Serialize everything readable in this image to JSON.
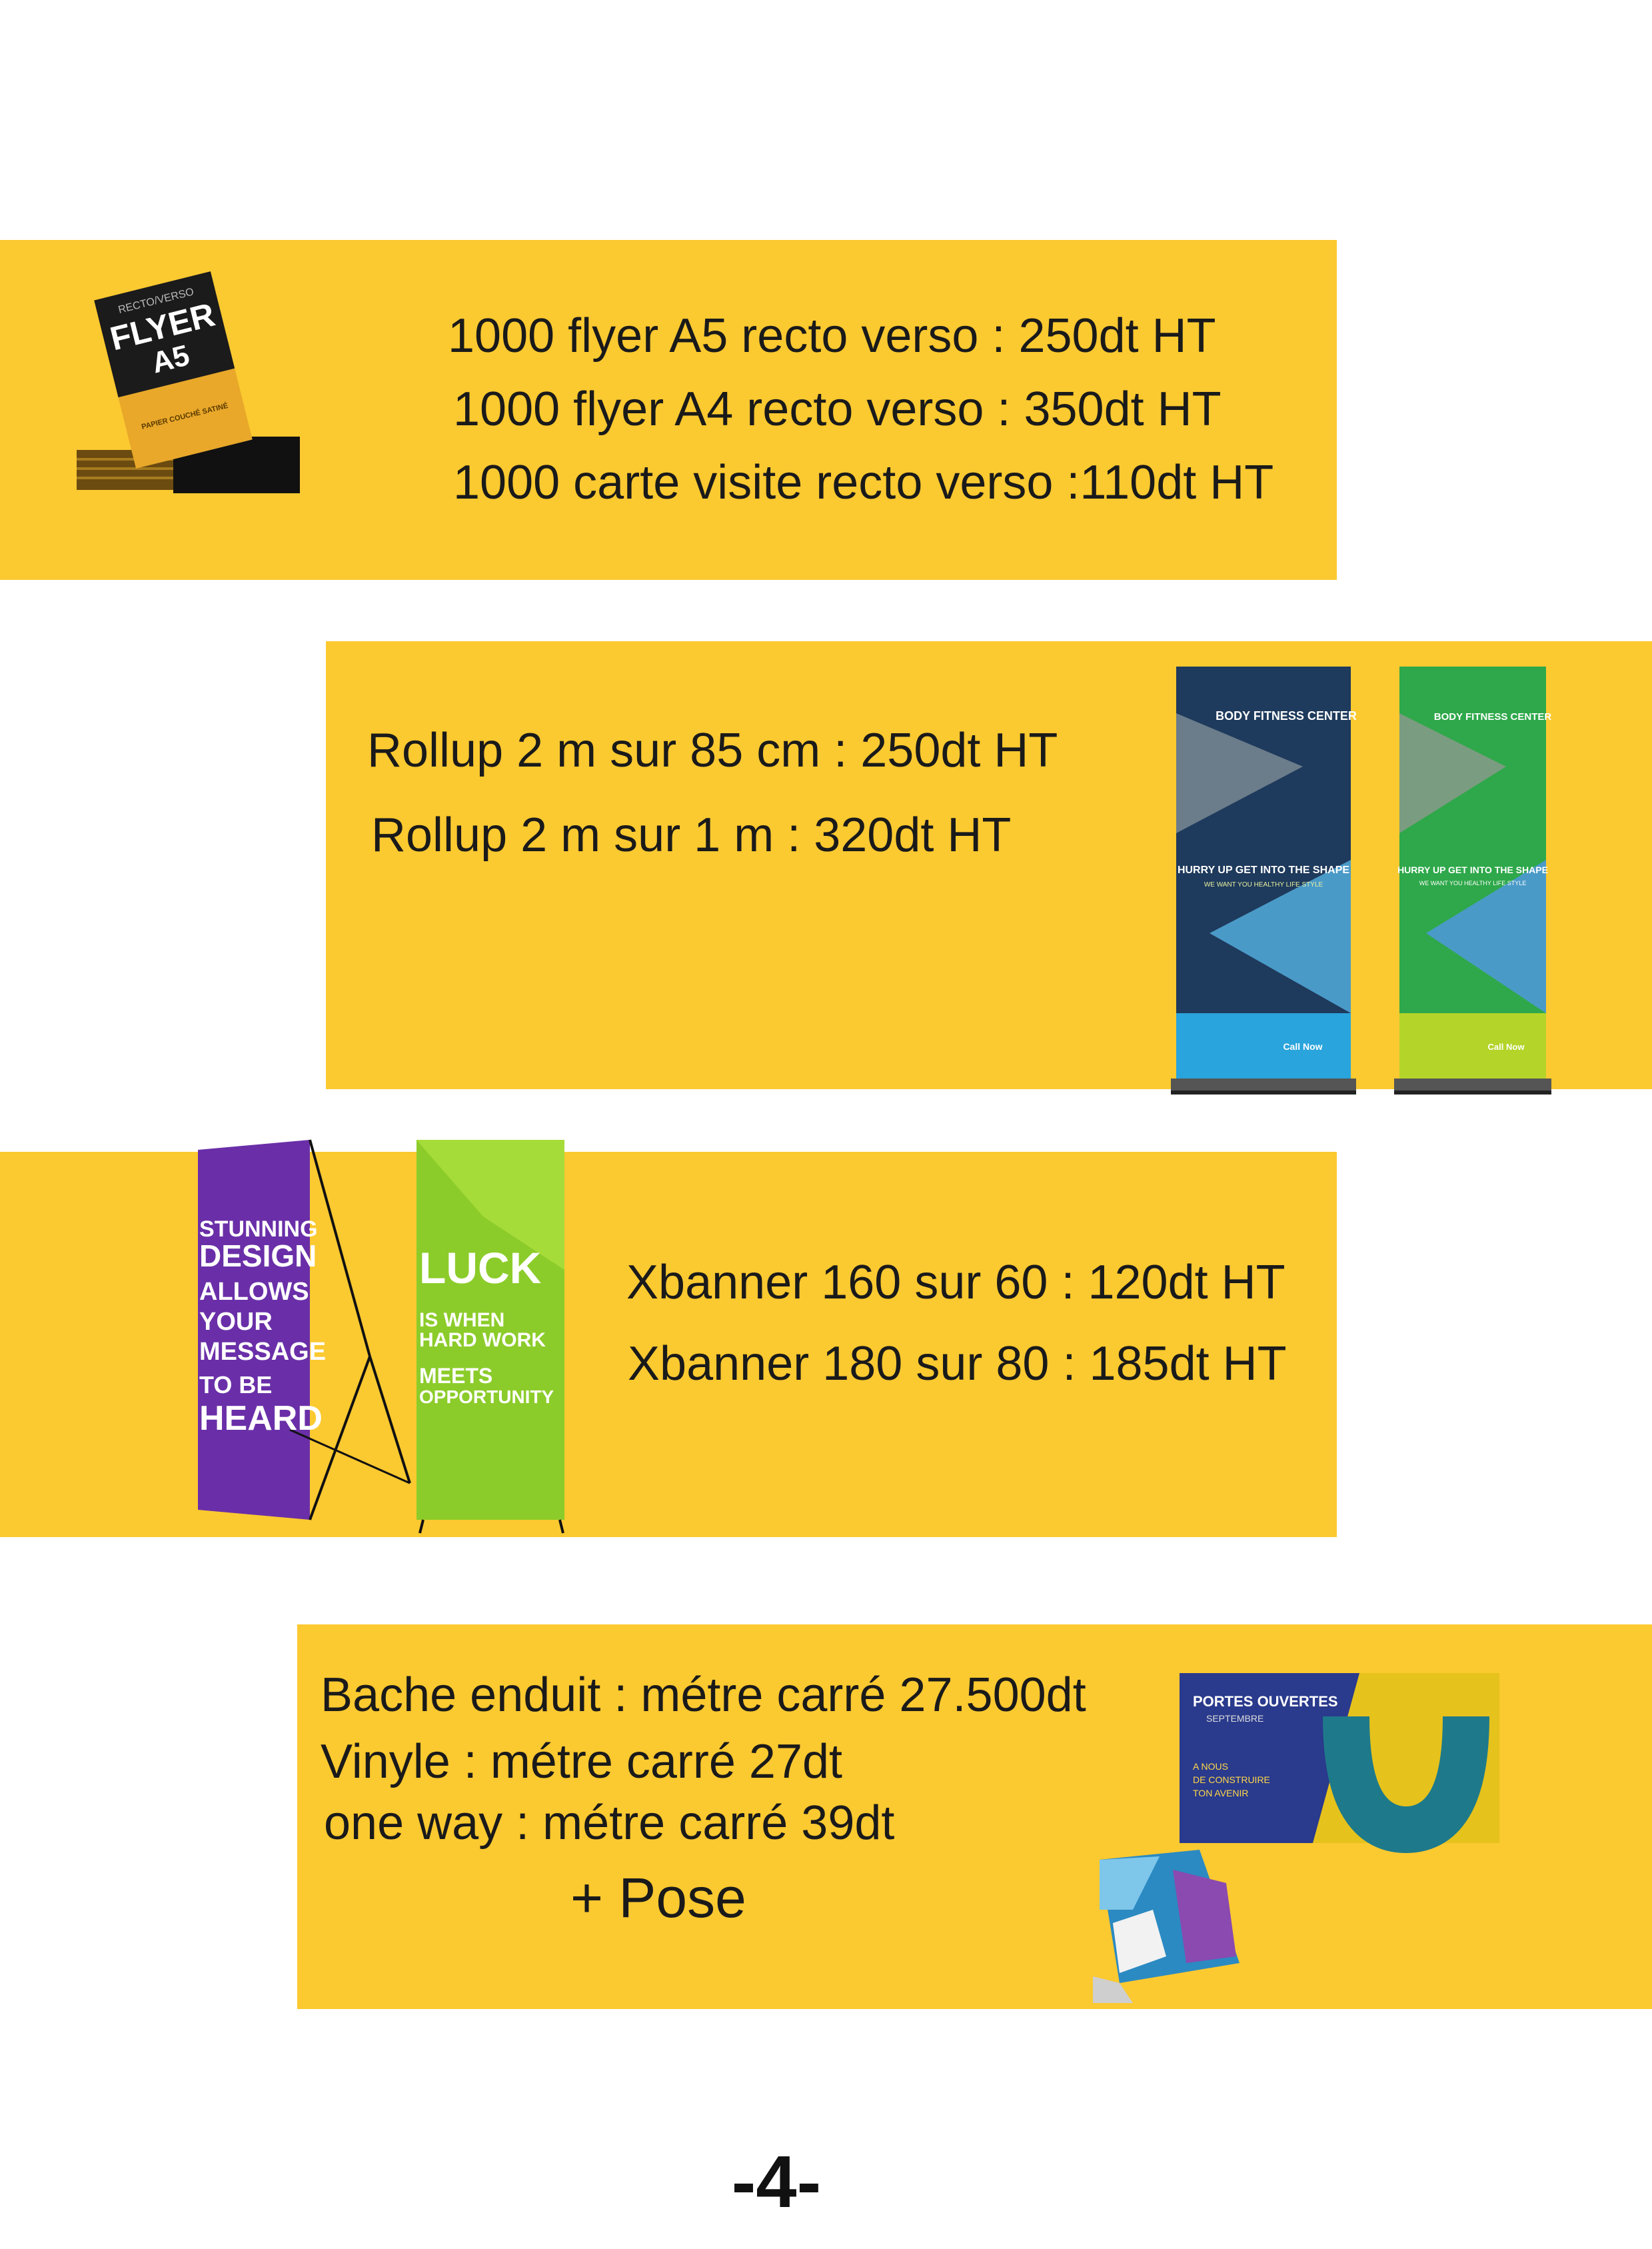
{
  "sections": [
    {
      "lines": [
        "1000 flyer A5 recto verso : 250dt HT",
        "1000 flyer A4 recto verso : 350dt HT",
        "1000 carte visite recto verso :110dt HT"
      ],
      "image": {
        "label_top": "RECTO/VERSO",
        "title_1": "FLYER",
        "title_2": "A5",
        "footer": "PAPIER COUCHÉ SATINÉ"
      }
    },
    {
      "lines": [
        "Rollup 2 m sur 85 cm : 250dt HT",
        "Rollup 2 m sur 1 m : 320dt HT"
      ],
      "image": {
        "brand": "BODY FITNESS CENTER",
        "headline": "HURRY UP GET INTO THE SHAPE",
        "subline": "WE WANT YOU HEALTHY LIFE STYLE",
        "cta": "Call Now"
      }
    },
    {
      "lines": [
        "Xbanner 160 sur 60  : 120dt HT",
        "Xbanner 180 sur 80  : 185dt HT"
      ],
      "image": {
        "purple_lines": [
          "STUNNING",
          "DESIGN",
          "ALLOWS",
          "YOUR",
          "MESSAGE",
          "TO BE",
          "HEARD"
        ],
        "green_lines": [
          "LUCK",
          "IS WHEN",
          "HARD WORK",
          "MEETS",
          "OPPORTUNITY"
        ]
      }
    },
    {
      "lines": [
        "Bache enduit  : métre carré 27.500dt",
        "Vinyle : métre carré 27dt",
        "one way : métre carré 39dt"
      ],
      "extra": "+ Pose",
      "image": {
        "title": "PORTES OUVERTES",
        "date": "SEPTEMBRE",
        "tagline": [
          "A NOUS",
          "DE CONSTRUIRE",
          "TON AVENIR"
        ]
      }
    }
  ],
  "page_number": "-4-",
  "colors": {
    "band": "#fbc930",
    "text": "#1a1a1a"
  }
}
